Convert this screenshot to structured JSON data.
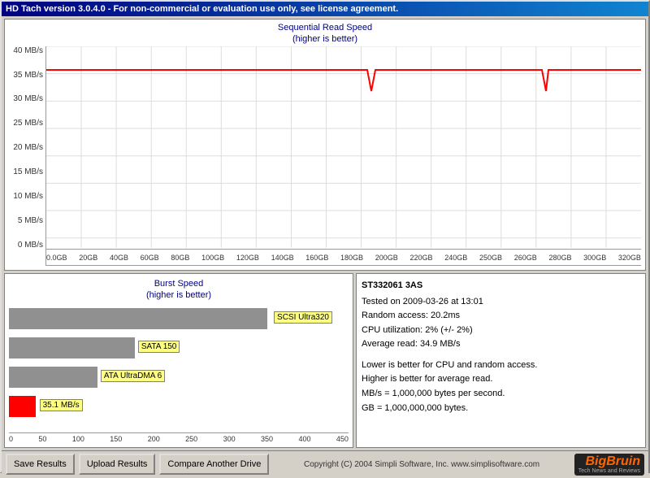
{
  "window": {
    "title": "HD Tach version 3.0.4.0  - For non-commercial or evaluation use only, see license agreement."
  },
  "top_chart": {
    "title_line1": "Sequential Read Speed",
    "title_line2": "(higher is better)",
    "y_labels": [
      "40 MB/s",
      "35 MB/s",
      "30 MB/s",
      "25 MB/s",
      "20 MB/s",
      "15 MB/s",
      "10 MB/s",
      "5 MB/s",
      "0 MB/s"
    ],
    "x_labels": [
      "0.0GB",
      "20GB",
      "40GB",
      "60GB",
      "80GB",
      "100GB",
      "120GB",
      "140GB",
      "160GB",
      "180GB",
      "200GB",
      "220GB",
      "240GB",
      "250GB",
      "260GB",
      "280GB",
      "300GB",
      "320GB"
    ]
  },
  "burst_chart": {
    "title_line1": "Burst Speed",
    "title_line2": "(higher is better)",
    "bars": [
      {
        "label": "SCSI Ultra320",
        "width_pct": 76,
        "color": "#808080"
      },
      {
        "label": "SATA 150",
        "width_pct": 37,
        "color": "#808080"
      },
      {
        "label": "ATA UltraDMA 6",
        "width_pct": 26,
        "color": "#808080"
      }
    ],
    "measured_label": "35.1 MB/s",
    "measured_width_pct": 8,
    "x_labels": [
      "0",
      "50",
      "100",
      "150",
      "200",
      "250",
      "300",
      "350",
      "400",
      "450"
    ]
  },
  "info_panel": {
    "title": "ST332061 3AS",
    "line1": "Tested on 2009-03-26 at 13:01",
    "line2": "Random access: 20.2ms",
    "line3": "CPU utilization: 2% (+/- 2%)",
    "line4": "Average read: 34.9 MB/s",
    "note1": "Lower is better for CPU and random access.",
    "note2": "Higher is better for average read.",
    "note3": "MB/s = 1,000,000 bytes per second.",
    "note4": "GB = 1,000,000,000 bytes."
  },
  "status_bar": {
    "save_label": "Save Results",
    "upload_label": "Upload Results",
    "compare_label": "Compare Another Drive",
    "copyright": "Copyright (C) 2004 Simpli Software, Inc. www.simplisoftware.com",
    "logo_main": "BigBruin",
    "logo_sub": "Tech News and Reviews"
  }
}
